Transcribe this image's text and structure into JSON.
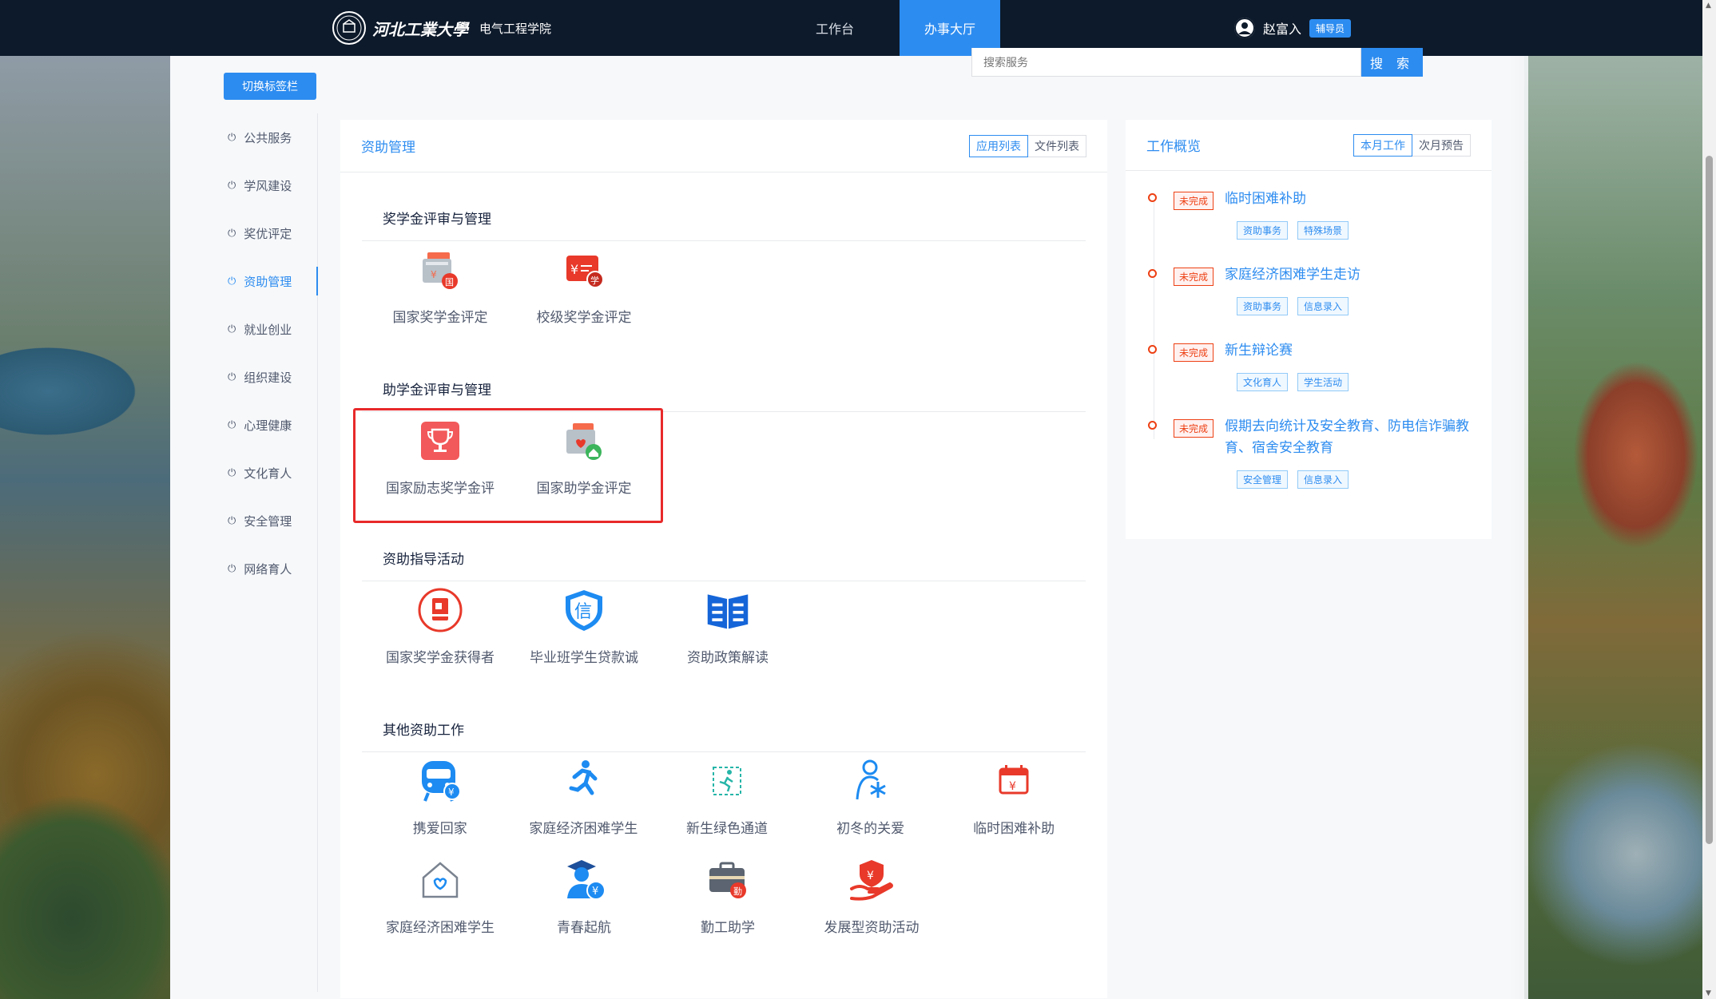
{
  "header": {
    "school_name": "河北工業大學",
    "school_seal": "河工大",
    "college": "电气工程学院",
    "nav": [
      {
        "label": "工作台"
      },
      {
        "label": "办事大厅"
      }
    ],
    "user_name": "赵富入",
    "user_role": "辅导员"
  },
  "toolbar": {
    "switch_label": "切换标签栏",
    "search_placeholder": "搜索服务",
    "search_button": "搜 索"
  },
  "sidebar": {
    "items": [
      {
        "label": "公共服务"
      },
      {
        "label": "学风建设"
      },
      {
        "label": "奖优评定"
      },
      {
        "label": "资助管理"
      },
      {
        "label": "就业创业"
      },
      {
        "label": "组织建设"
      },
      {
        "label": "心理健康"
      },
      {
        "label": "文化育人"
      },
      {
        "label": "安全管理"
      },
      {
        "label": "网络育人"
      }
    ],
    "active": "资助管理"
  },
  "main": {
    "title": "资助管理",
    "toggle": [
      "应用列表",
      "文件列表"
    ],
    "sections": [
      {
        "title": "奖学金评审与管理",
        "apps": [
          {
            "label": "国家奖学金评定",
            "icon": "scholarship-cert-icon"
          },
          {
            "label": "校级奖学金评定",
            "icon": "school-scholarship-icon"
          }
        ]
      },
      {
        "title": "助学金评审与管理",
        "apps": [
          {
            "label": "国家励志奖学金评",
            "icon": "trophy-icon"
          },
          {
            "label": "国家助学金评定",
            "icon": "grant-envelope-icon"
          }
        ]
      },
      {
        "title": "资助指导活动",
        "apps": [
          {
            "label": "国家奖学金获得者",
            "icon": "award-book-icon"
          },
          {
            "label": "毕业班学生贷款诚",
            "icon": "trust-shield-icon"
          },
          {
            "label": "资助政策解读",
            "icon": "policy-book-icon"
          }
        ]
      },
      {
        "title": "其他资助工作",
        "apps": [
          {
            "label": "携爱回家",
            "icon": "train-icon"
          },
          {
            "label": "家庭经济困难学生",
            "icon": "running-person-icon"
          },
          {
            "label": "新生绿色通道",
            "icon": "green-channel-icon"
          },
          {
            "label": "初冬的关爱",
            "icon": "winter-care-icon"
          },
          {
            "label": "临时困难补助",
            "icon": "calendar-yen-icon"
          },
          {
            "label": "家庭经济困难学生",
            "icon": "house-heart-icon"
          },
          {
            "label": "青春起航",
            "icon": "graduate-yen-icon"
          },
          {
            "label": "勤工助学",
            "icon": "work-study-icon"
          },
          {
            "label": "发展型资助活动",
            "icon": "hand-yen-icon"
          }
        ]
      }
    ]
  },
  "overview": {
    "title": "工作概览",
    "toggle": [
      "本月工作",
      "次月预告"
    ],
    "items": [
      {
        "status": "未完成",
        "title": "临时困难补助",
        "tags": [
          "资助事务",
          "特殊场景"
        ]
      },
      {
        "status": "未完成",
        "title": "家庭经济困难学生走访",
        "tags": [
          "资助事务",
          "信息录入"
        ]
      },
      {
        "status": "未完成",
        "title": "新生辩论赛",
        "tags": [
          "文化育人",
          "学生活动"
        ]
      },
      {
        "status": "未完成",
        "title": "假期去向统计及安全教育、防电信诈骗教育、宿舍安全教育",
        "tags": [
          "安全管理",
          "信息录入"
        ]
      }
    ]
  },
  "colors": {
    "primary": "#2d8cf0",
    "header_bg": "#0d1a2b",
    "danger": "#ed4014",
    "highlight_box": "#e8292a"
  }
}
